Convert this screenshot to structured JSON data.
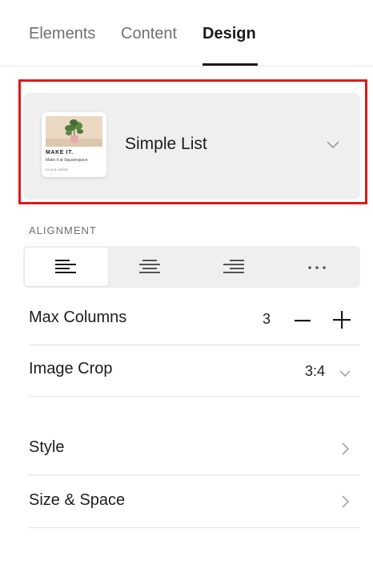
{
  "tabs": [
    {
      "label": "Elements"
    },
    {
      "label": "Content"
    },
    {
      "label": "Design"
    }
  ],
  "layout": {
    "name": "Simple List",
    "thumbnail": {
      "title": "MAKE IT.",
      "subtitle": "Make it at Squarespace",
      "link": "CLICK HERE"
    }
  },
  "alignment": {
    "label": "ALIGNMENT",
    "options": [
      "align-left-icon",
      "align-center-icon",
      "align-right-icon",
      "more-icon"
    ],
    "selected": "left"
  },
  "max_columns": {
    "label": "Max Columns",
    "value": "3"
  },
  "image_crop": {
    "label": "Image Crop",
    "value": "3:4"
  },
  "style": {
    "label": "Style"
  },
  "size_space": {
    "label": "Size & Space"
  },
  "colors": {
    "highlight": "#e01818",
    "card_bg": "#efefef",
    "active_tab": "#1a1a1a"
  }
}
